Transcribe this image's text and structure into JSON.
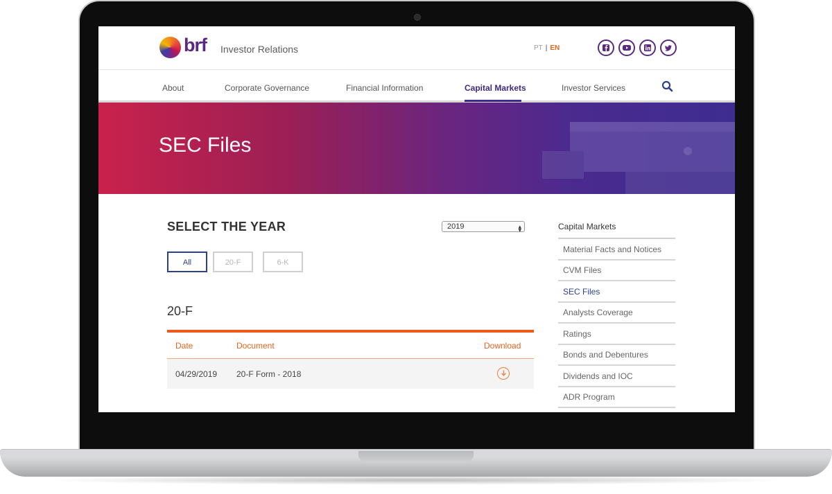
{
  "header": {
    "logo_text": "brf",
    "site_title": "Investor Relations",
    "lang_pt": "PT",
    "lang_sep": "|",
    "lang_en": "EN",
    "social": [
      "facebook-icon",
      "youtube-icon",
      "linkedin-icon",
      "twitter-icon"
    ]
  },
  "nav": {
    "items": [
      "About",
      "Corporate Governance",
      "Financial Information",
      "Capital Markets",
      "Investor Services"
    ],
    "active": "Capital Markets"
  },
  "hero": {
    "title": "SEC Files"
  },
  "filters": {
    "heading": "SELECT THE YEAR",
    "year": "2019",
    "buttons": [
      "All",
      "20-F",
      "6-K"
    ],
    "active": "All"
  },
  "section": {
    "title": "20-F",
    "columns": [
      "Date",
      "Document",
      "Download"
    ],
    "rows": [
      {
        "date": "04/29/2019",
        "document": "20-F Form - 2018"
      }
    ]
  },
  "sidebar": {
    "heading": "Capital Markets",
    "items": [
      "Material Facts and Notices",
      "CVM Files",
      "SEC Files",
      "Analysts Coverage",
      "Ratings",
      "Bonds and Debentures",
      "Dividends and IOC",
      "ADR Program"
    ],
    "active": "SEC Files"
  },
  "colors": {
    "brand_purple": "#5a2a82",
    "nav_active": "#3b2a86",
    "accent_orange": "#ef5a1c",
    "hero_start": "#c9224c",
    "hero_end": "#3e2d90"
  }
}
